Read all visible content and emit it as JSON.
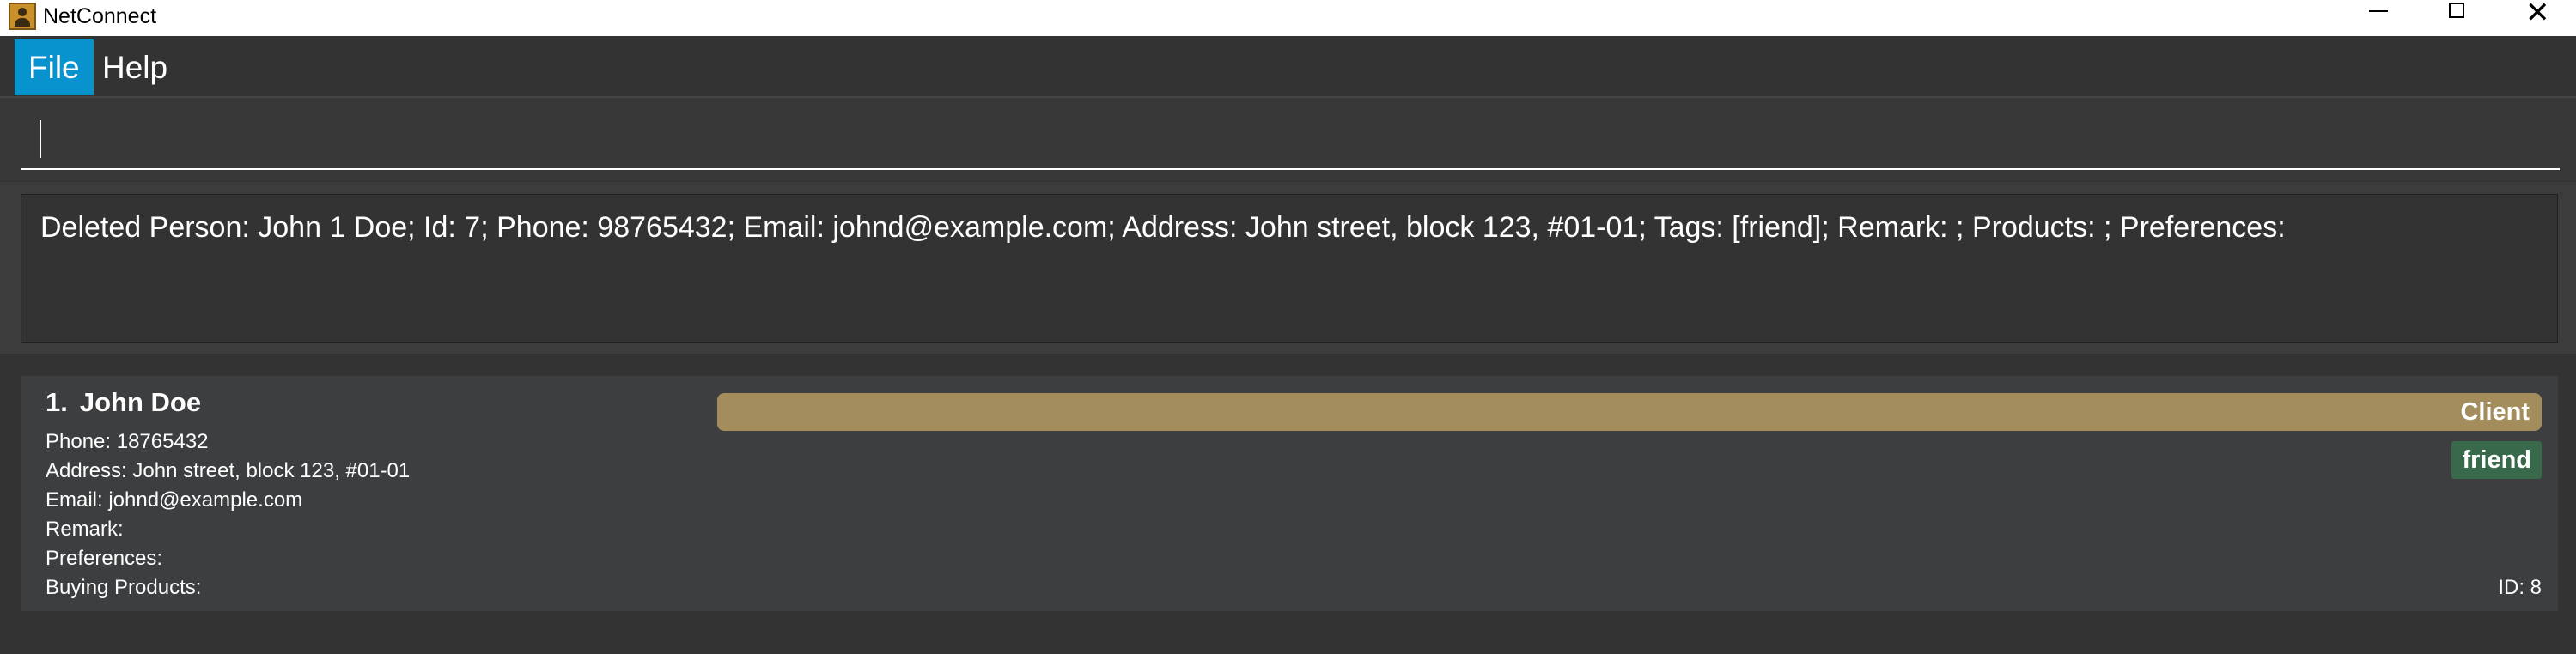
{
  "window": {
    "title": "NetConnect",
    "icons": {
      "app": "address-book-icon",
      "minimize": "minimize-icon",
      "maximize": "maximize-icon",
      "close": "close-icon"
    }
  },
  "menu": {
    "file_label": "File",
    "help_label": "Help",
    "active_color": "#0893cf"
  },
  "command": {
    "value": "",
    "placeholder": ""
  },
  "result": {
    "message": "Deleted Person: John 1 Doe; Id: 7; Phone: 98765432; Email: johnd@example.com; Address: John street, block 123, #01-01; Tags: [friend]; Remark: ; Products: ; Preferences:"
  },
  "persons": [
    {
      "index": "1.",
      "name": "John Doe",
      "phone": "Phone: 18765432",
      "address": "Address: John street, block 123, #01-01",
      "email": "Email: johnd@example.com",
      "remark": "Remark:",
      "preferences": "Preferences:",
      "products": "Buying Products:",
      "tier": "Client",
      "tier_color": "#a48d5c",
      "tags": [
        "friend"
      ],
      "tag_color": "#37694a",
      "id": "ID: 8"
    }
  ],
  "colors": {
    "background": "#333333",
    "card": "#3c3e40"
  }
}
